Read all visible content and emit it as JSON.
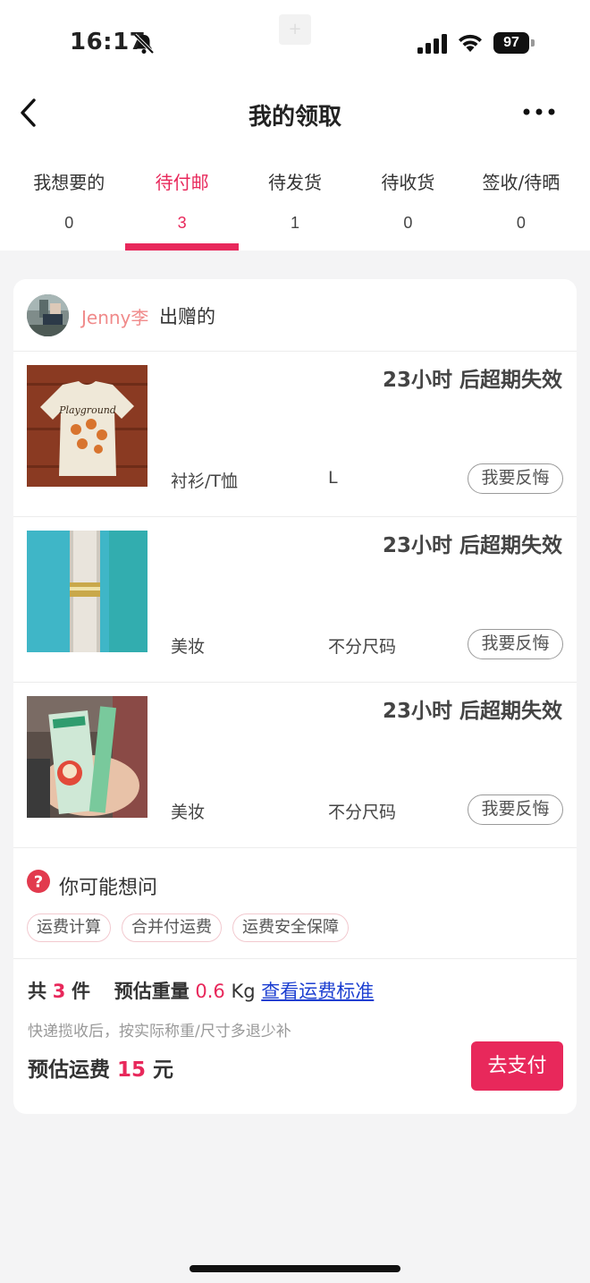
{
  "status_bar": {
    "time": "16:17",
    "battery": "97"
  },
  "nav": {
    "title": "我的领取"
  },
  "tabs": [
    {
      "label": "我想要的",
      "count": "0"
    },
    {
      "label": "待付邮",
      "count": "3"
    },
    {
      "label": "待发货",
      "count": "1"
    },
    {
      "label": "待收货",
      "count": "0"
    },
    {
      "label": "签收/待晒",
      "count": "0"
    }
  ],
  "active_tab": 1,
  "giver": {
    "name": "Jenny李",
    "suffix": "出赠的"
  },
  "items": [
    {
      "expire": "23小时 后超期失效",
      "category": "衬衫/T恤",
      "size": "L",
      "action": "我要反悔",
      "thumb_text": "Playground"
    },
    {
      "expire": "23小时 后超期失效",
      "category": "美妆",
      "size": "不分尺码",
      "action": "我要反悔"
    },
    {
      "expire": "23小时 后超期失效",
      "category": "美妆",
      "size": "不分尺码",
      "action": "我要反悔"
    }
  ],
  "faq": {
    "title": "你可能想问",
    "chips": [
      "运费计算",
      "合并付运费",
      "运费安全保障"
    ]
  },
  "summary": {
    "total_prefix": "共",
    "total_count": "3",
    "total_suffix": "件",
    "weight_label": "预估重量",
    "weight_value": "0.6",
    "weight_unit": "Kg",
    "rule_link": "查看运费标准",
    "note": "快递揽收后，按实际称重/尺寸多退少补",
    "fee_label": "预估运费",
    "fee_value": "15",
    "fee_unit": "元",
    "pay_button": "去支付"
  },
  "colors": {
    "accent": "#e8285b",
    "link": "#1c3fd1",
    "giver_name": "#f08a8a"
  }
}
